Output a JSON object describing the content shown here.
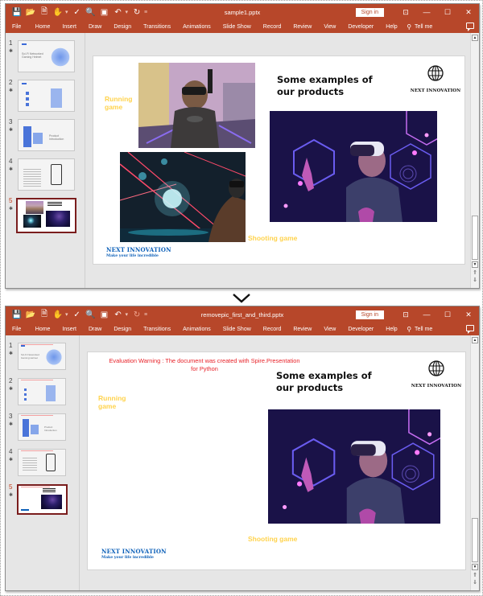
{
  "ribbon_tabs": [
    "File",
    "Home",
    "Insert",
    "Draw",
    "Design",
    "Transitions",
    "Animations",
    "Slide Show",
    "Record",
    "Review",
    "View",
    "Developer",
    "Help"
  ],
  "tell_me": "Tell me",
  "sign_in": "Sign in",
  "quick_access_icons": [
    "save-icon",
    "open-folder-icon",
    "new-file-icon",
    "touch-mode-icon",
    "spelling-icon",
    "print-preview-icon",
    "present-icon",
    "undo-icon",
    "redo-icon",
    "customize-icon"
  ],
  "window_controls": {
    "ribbon_display": "⊡",
    "minimize": "—",
    "maximize": "☐",
    "close": "✕"
  },
  "before": {
    "file_name": "sample1.pptx",
    "slides": [
      {
        "number": "1",
        "caption": "Sci-Fi Networked Gaming Helmet"
      },
      {
        "number": "2",
        "caption": ""
      },
      {
        "number": "3",
        "caption": "Product Introduction"
      },
      {
        "number": "4",
        "caption": ""
      },
      {
        "number": "5",
        "caption": "Some examples of our products",
        "active": true
      }
    ],
    "slide": {
      "heading_line1": "Some examples of",
      "heading_line2": "our products",
      "logo_text": "NEXT INNOVATION",
      "running_label_line1": "Running",
      "running_label_line2": "game",
      "shooting_label": "Shooting game",
      "brand_name": "NEXT INNOVATION",
      "brand_tagline": "Make your life incredible",
      "images": [
        "running-game-photo",
        "shooting-game-photo",
        "vr-headset-photo"
      ]
    }
  },
  "after": {
    "file_name": "removepic_first_and_third.pptx",
    "slides": [
      {
        "number": "1",
        "caption": "Sci-Fi Networked Gaming Helmet"
      },
      {
        "number": "2",
        "caption": ""
      },
      {
        "number": "3",
        "caption": "Product Introduction"
      },
      {
        "number": "4",
        "caption": ""
      },
      {
        "number": "5",
        "caption": "Some examples of our products",
        "active": true
      }
    ],
    "slide": {
      "warning_line1": "Evaluation Warning : The document was created with Spire.Presentation",
      "warning_line2": "for Python",
      "heading_line1": "Some examples of",
      "heading_line2": "our products",
      "logo_text": "NEXT INNOVATION",
      "running_label_line1": "Running",
      "running_label_line2": "game",
      "shooting_label": "Shooting game",
      "brand_name": "NEXT INNOVATION",
      "brand_tagline": "Make your life incredible",
      "images": [
        "vr-headset-photo"
      ]
    }
  },
  "transition_icon": "chevron-down-icon"
}
